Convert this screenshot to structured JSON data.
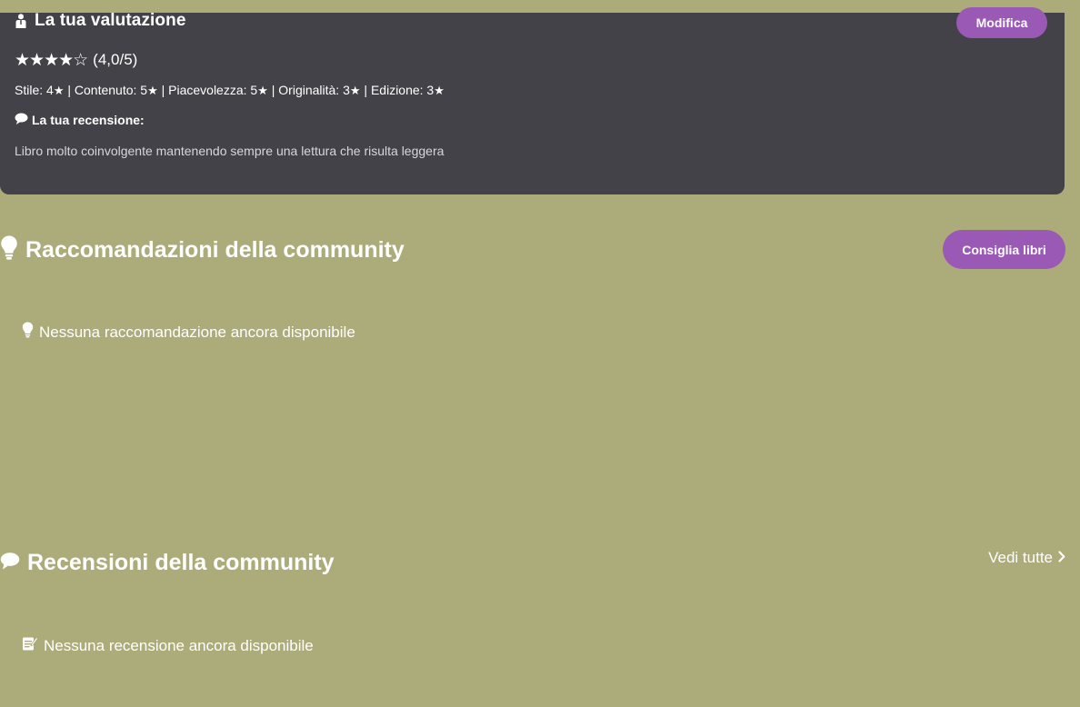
{
  "rating": {
    "title": "La tua valutazione",
    "edit_label": "Modifica",
    "stars": "★★★★☆",
    "score": "(4,0/5)",
    "criteria": [
      {
        "label": "Stile: 4",
        "sep": " | "
      },
      {
        "label": "Contenuto: 5",
        "sep": " | "
      },
      {
        "label": "Piacevolezza: 5",
        "sep": " | "
      },
      {
        "label": "Originalità: 3",
        "sep": " | "
      },
      {
        "label": "Edizione: 3",
        "sep": ""
      }
    ],
    "star_glyph": "★",
    "review_label": "La tua recensione:",
    "review_text": "Libro molto coinvolgente mantenendo sempre una lettura che risulta leggera"
  },
  "recommendations": {
    "title": "Raccomandazioni della community",
    "button_label": "Consiglia libri",
    "empty_text": "Nessuna raccomandazione ancora disponibile",
    "icon": "lightbulb-icon"
  },
  "reviews": {
    "title": "Recensioni della community",
    "view_all_label": "Vedi tutte",
    "empty_text": "Nessuna recensione ancora disponibile",
    "icon": "comment-icon"
  },
  "colors": {
    "background": "#acab7a",
    "card": "#434248",
    "accent": "#9a59b5"
  }
}
